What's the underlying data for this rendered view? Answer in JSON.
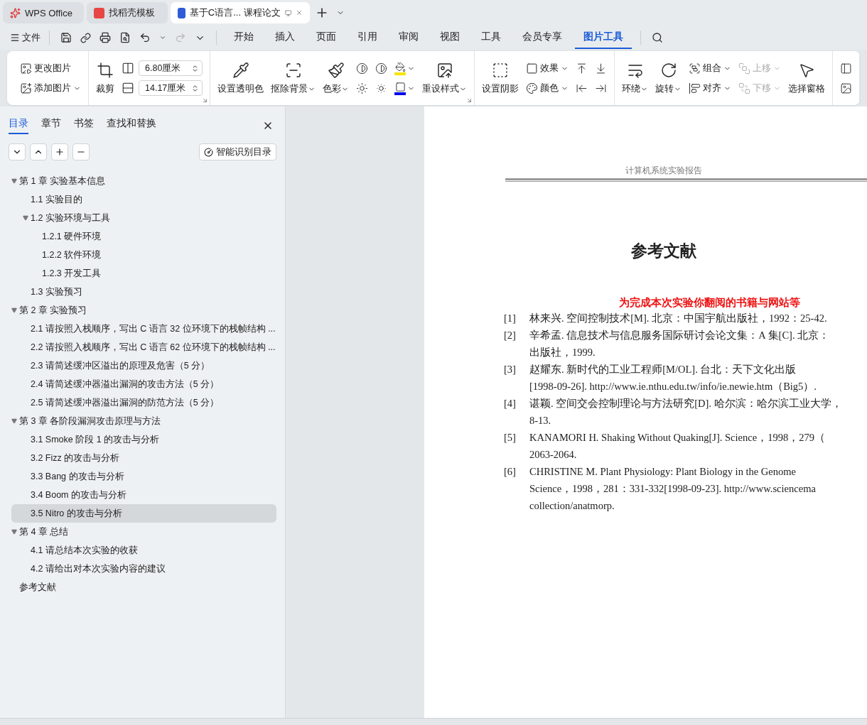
{
  "title_tabs": [
    {
      "kind": "wps",
      "label": "WPS Office",
      "selected": false
    },
    {
      "kind": "template",
      "label": "找稻壳模板",
      "selected": false
    },
    {
      "kind": "doc",
      "label": "基于C语言... 课程论文",
      "selected": true
    }
  ],
  "menu": {
    "file": "文件",
    "items": [
      {
        "label": "开始",
        "selected": false
      },
      {
        "label": "插入",
        "selected": false
      },
      {
        "label": "页面",
        "selected": false
      },
      {
        "label": "引用",
        "selected": false
      },
      {
        "label": "审阅",
        "selected": false
      },
      {
        "label": "视图",
        "selected": false
      },
      {
        "label": "工具",
        "selected": false
      },
      {
        "label": "会员专享",
        "selected": false
      },
      {
        "label": "图片工具",
        "selected": true
      }
    ]
  },
  "ribbon": [
    {
      "columns": [
        [
          {
            "kind": "small",
            "label": "更改图片",
            "dropdown": false,
            "disabled": false
          },
          {
            "kind": "small",
            "label": "添加图片",
            "dropdown": true,
            "disabled": false
          }
        ]
      ]
    },
    {
      "launcher": true,
      "columns": [
        [
          {
            "kind": "large",
            "label": "裁剪",
            "dropdown": false,
            "disabled": false
          }
        ],
        [
          {
            "kind": "spin",
            "value": "6.80厘米"
          },
          {
            "kind": "spin",
            "value": "14.17厘米"
          }
        ]
      ]
    },
    {
      "launcher": true,
      "columns": [
        [
          {
            "kind": "large",
            "label": "设置透明色",
            "dropdown": false,
            "disabled": false
          }
        ],
        [
          {
            "kind": "large",
            "label": "抠除背景",
            "dropdown": true,
            "disabled": false
          }
        ],
        [
          {
            "kind": "large",
            "label": "色彩",
            "dropdown": true,
            "disabled": false
          }
        ],
        [
          {
            "kind": "icon"
          },
          {
            "kind": "icon"
          }
        ],
        [
          {
            "kind": "icon"
          },
          {
            "kind": "icon"
          }
        ],
        [
          {
            "kind": "swatch",
            "color": "#f5e400",
            "dropdown": true
          },
          {
            "kind": "swatch",
            "color": "#0000ee",
            "dropdown": true
          }
        ],
        [
          {
            "kind": "large",
            "label": "重设样式",
            "dropdown": true,
            "disabled": false
          }
        ]
      ]
    },
    {
      "columns": [
        [
          {
            "kind": "large",
            "label": "设置阴影",
            "dropdown": false,
            "disabled": false
          }
        ],
        [
          {
            "kind": "small",
            "label": "效果",
            "dropdown": true,
            "disabled": false
          },
          {
            "kind": "small",
            "label": "颜色",
            "dropdown": true,
            "disabled": false
          }
        ],
        [
          {
            "kind": "icon"
          },
          {
            "kind": "icon"
          }
        ],
        [
          {
            "kind": "icon"
          },
          {
            "kind": "icon"
          }
        ]
      ]
    },
    {
      "columns": [
        [
          {
            "kind": "large",
            "label": "环绕",
            "dropdown": true,
            "disabled": false
          }
        ],
        [
          {
            "kind": "large",
            "label": "旋转",
            "dropdown": true,
            "disabled": false
          }
        ],
        [
          {
            "kind": "small",
            "label": "组合",
            "dropdown": true,
            "disabled": false
          },
          {
            "kind": "small",
            "label": "对齐",
            "dropdown": true,
            "disabled": false
          }
        ],
        [
          {
            "kind": "small",
            "label": "上移",
            "dropdown": true,
            "disabled": true
          },
          {
            "kind": "small",
            "label": "下移",
            "dropdown": true,
            "disabled": true
          }
        ],
        [
          {
            "kind": "large",
            "label": "选择窗格",
            "dropdown": false,
            "disabled": false
          }
        ]
      ]
    },
    {
      "columns": [
        [
          {
            "kind": "icon"
          },
          {
            "kind": "icon"
          }
        ]
      ]
    }
  ],
  "nav": {
    "tabs": [
      {
        "label": "目录",
        "selected": true
      },
      {
        "label": "章节",
        "selected": false
      },
      {
        "label": "书签",
        "selected": false
      },
      {
        "label": "查找和替换",
        "selected": false
      }
    ],
    "smart_button": "智能识别目录",
    "outline": [
      {
        "label": "第 1 章  实验基本信息",
        "expanded": true,
        "selected": false,
        "children": [
          {
            "label": "1.1  实验目的",
            "selected": false
          },
          {
            "label": "1.2 实验环境与工具",
            "expanded": true,
            "selected": false,
            "children": [
              {
                "label": "1.2.1  硬件环境",
                "selected": false
              },
              {
                "label": "1.2.2  软件环境",
                "selected": false
              },
              {
                "label": "1.2.3  开发工具",
                "selected": false
              }
            ]
          },
          {
            "label": "1.3  实验预习",
            "selected": false
          }
        ]
      },
      {
        "label": "第 2 章  实验预习",
        "expanded": true,
        "selected": false,
        "children": [
          {
            "label": "2.1  请按照入栈顺序，写出 C 语言 32 位环境下的栈帧结构 ...",
            "selected": false
          },
          {
            "label": "2.2 请按照入栈顺序，写出 C 语言 62 位环境下的栈帧结构 ...",
            "selected": false
          },
          {
            "label": "2.3 请简述缓冲区溢出的原理及危害（5 分）",
            "selected": false
          },
          {
            "label": "2.4 请简述缓冲器溢出漏洞的攻击方法（5 分）",
            "selected": false
          },
          {
            "label": "2.5 请简述缓冲器溢出漏洞的防范方法（5 分）",
            "selected": false
          }
        ]
      },
      {
        "label": "第 3 章  各阶段漏洞攻击原理与方法",
        "expanded": true,
        "selected": false,
        "children": [
          {
            "label": "3.1 Smoke 阶段 1 的攻击与分析",
            "selected": false
          },
          {
            "label": "3.2 Fizz 的攻击与分析",
            "selected": false
          },
          {
            "label": "3.3 Bang 的攻击与分析",
            "selected": false
          },
          {
            "label": "3.4 Boom 的攻击与分析",
            "selected": false
          },
          {
            "label": "3.5 Nitro 的攻击与分析",
            "selected": true
          }
        ]
      },
      {
        "label": "第 4 章  总结",
        "expanded": true,
        "selected": false,
        "children": [
          {
            "label": "4.1  请总结本次实验的收获",
            "selected": false
          },
          {
            "label": "4.2  请给出对本次实验内容的建议",
            "selected": false
          }
        ]
      },
      {
        "label": "参考文献",
        "selected": false
      }
    ]
  },
  "document": {
    "header": "计算机系统实验报告",
    "title": "参考文献",
    "subtitle": "为完成本次实验你翻阅的书籍与网站等",
    "references": [
      {
        "number": "[1]",
        "lines": [
          "林来兴. 空间控制技术[M]. 北京：中国宇航出版社，1992：25-42."
        ]
      },
      {
        "number": "[2]",
        "lines": [
          "辛希孟. 信息技术与信息服务国际研讨会论文集：A 集[C]. 北京：",
          "出版社，1999."
        ]
      },
      {
        "number": "[3]",
        "lines": [
          "赵耀东. 新时代的工业工程师[M/OL]. 台北：天下文化出版",
          "[1998-09-26]. http://www.ie.nthu.edu.tw/info/ie.newie.htm（Big5）."
        ]
      },
      {
        "number": "[4]",
        "lines": [
          "谌颖. 空间交会控制理论与方法研究[D]. 哈尔滨：哈尔滨工业大学，",
          "8-13."
        ]
      },
      {
        "number": "[5]",
        "lines": [
          "KANAMORI H. Shaking Without Quaking[J]. Science，1998，279（",
          "2063-2064."
        ]
      },
      {
        "number": "[6]",
        "lines": [
          "CHRISTINE M. Plant Physiology: Plant Biology in the Genome",
          "Science，1998，281：331-332[1998-09-23]. http://www.sciencema",
          "collection/anatmorp."
        ]
      }
    ]
  }
}
